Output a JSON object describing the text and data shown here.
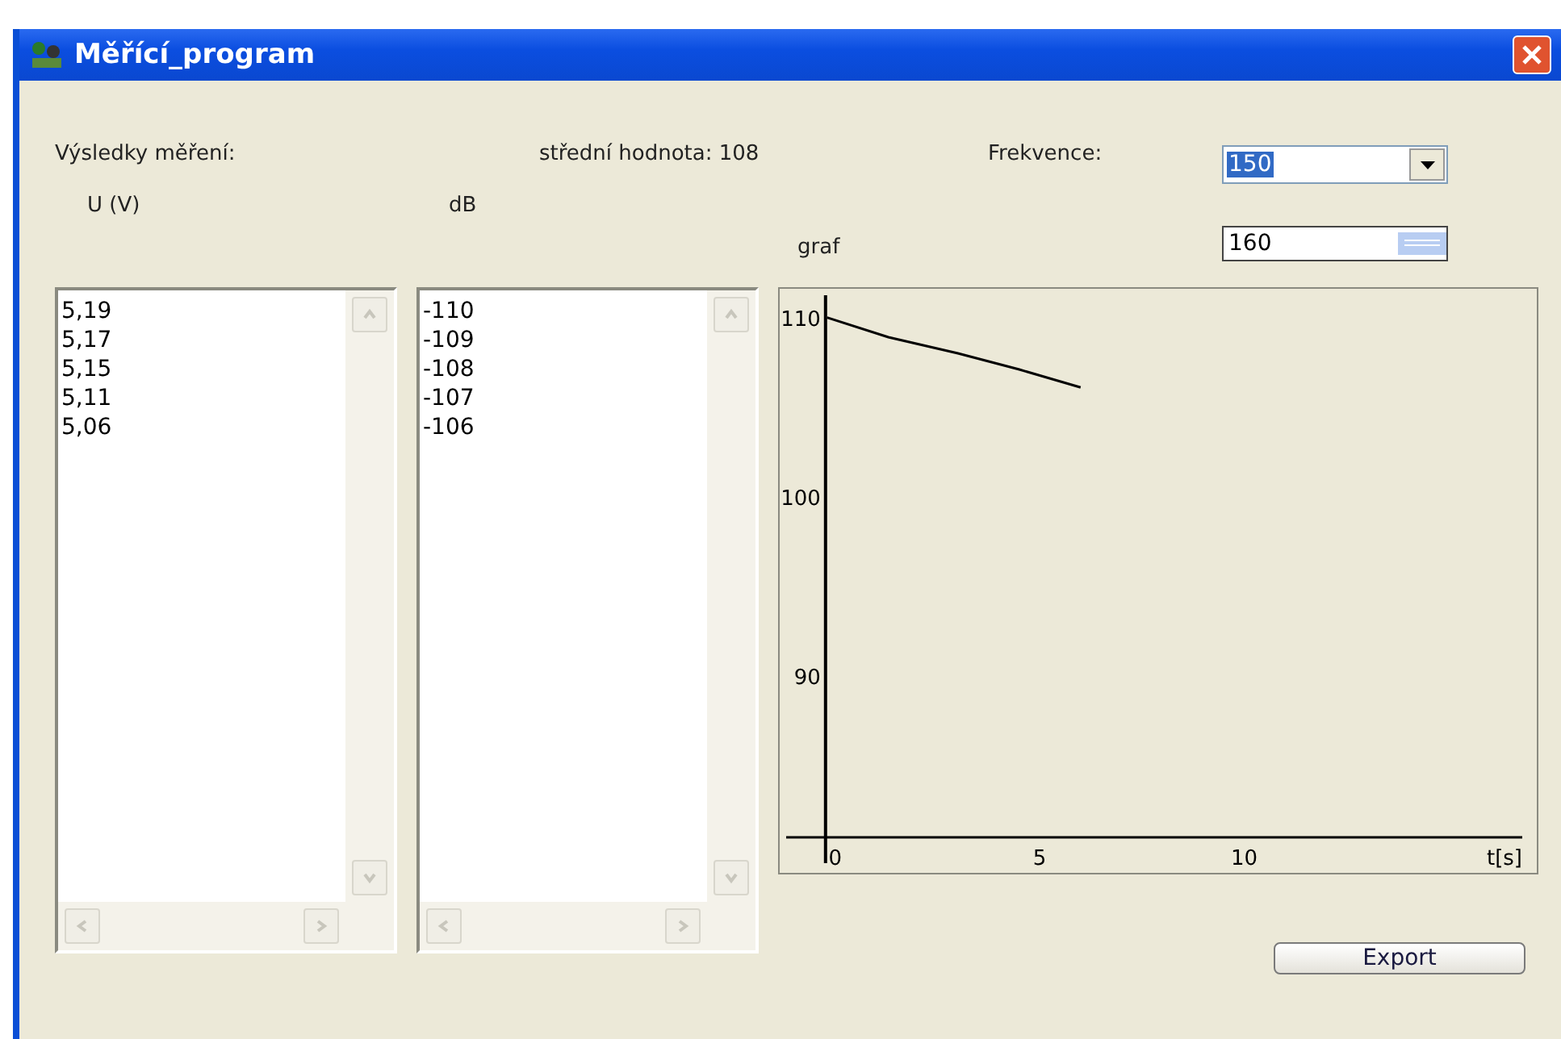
{
  "window": {
    "title": "Měřící_program"
  },
  "results_label": "Výsledky měření:",
  "mean_label": "střední hodnota: 108",
  "frequency": {
    "label": "Frekvence:",
    "value": "150",
    "value_selected": true,
    "second_value": "160"
  },
  "columns": [
    {
      "header": "U (V)",
      "items": [
        "5,19",
        "5,17",
        "5,15",
        "5,11",
        "5,06"
      ]
    },
    {
      "header": "dB",
      "items": [
        "-110",
        "-109",
        "-108",
        "-107",
        "-106"
      ]
    }
  ],
  "graph": {
    "title": "graf",
    "chart_data": {
      "type": "line",
      "xlabel": "t[s]",
      "x": [
        -0.2,
        1.3,
        3,
        4.5,
        6
      ],
      "series": [
        {
          "color": "#000000",
          "values": [
            110,
            108.9,
            108,
            107.1,
            106.1
          ]
        }
      ],
      "xlim": [
        -1.2,
        16.8
      ],
      "ylim": [
        81,
        111.6
      ],
      "xticks": [
        0,
        5,
        10
      ],
      "yticks": [
        90,
        100,
        110
      ]
    }
  },
  "buttons": [
    "Export"
  ]
}
